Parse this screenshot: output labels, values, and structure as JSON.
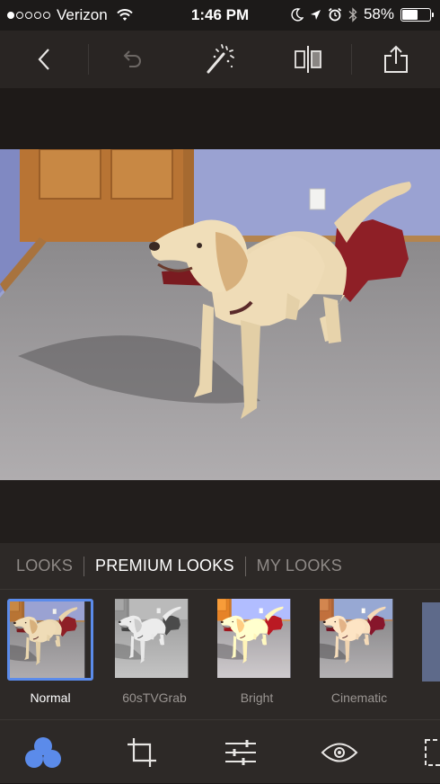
{
  "status_bar": {
    "carrier": "Verizon",
    "time": "1:46 PM",
    "battery_percent": "58%",
    "battery_level": 0.58,
    "signal_bars_filled": 1,
    "signal_bars_total": 5,
    "icons": [
      "wifi-icon",
      "moon-icon",
      "location-arrow-icon",
      "alarm-icon",
      "bluetooth-icon",
      "battery-icon"
    ]
  },
  "toolbar": {
    "buttons": [
      "back-chevron-icon",
      "undo-icon",
      "auto-enhance-wand-icon",
      "compare-split-icon",
      "share-icon"
    ],
    "undo_enabled": false
  },
  "looks_tabs": {
    "items": [
      {
        "label": "LOOKS",
        "active": false
      },
      {
        "label": "PREMIUM LOOKS",
        "active": true
      },
      {
        "label": "MY LOOKS",
        "active": false
      }
    ]
  },
  "looks": {
    "items": [
      {
        "label": "Normal",
        "selected": true,
        "filter": "none"
      },
      {
        "label": "60sTVGrab",
        "selected": false,
        "filter": "grayscale"
      },
      {
        "label": "Bright",
        "selected": false,
        "filter": "bright"
      },
      {
        "label": "Cinematic",
        "selected": false,
        "filter": "cinematic"
      }
    ]
  },
  "bottom_bar": {
    "items": [
      "looks-circles-icon",
      "crop-icon",
      "adjust-sliders-icon",
      "eye-icon",
      "selection-icon"
    ],
    "active": "looks-circles-icon"
  },
  "colors": {
    "accent": "#5b8bea",
    "background": "#2d2927",
    "wall": "#8e99cf",
    "carpet": "#a7a4a6",
    "door": "#b9783a",
    "dog": "#ecd8b2"
  }
}
